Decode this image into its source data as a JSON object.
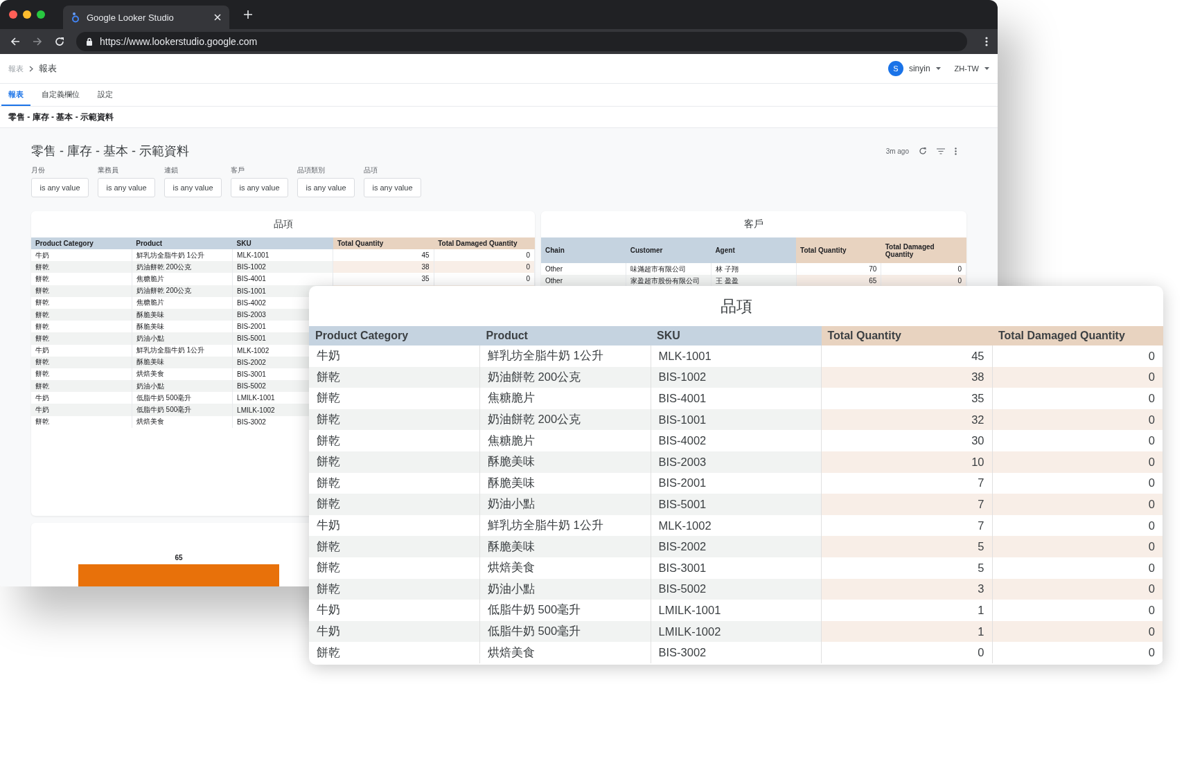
{
  "browser": {
    "tab_title": "Google Looker Studio",
    "url": "https://www.lookerstudio.google.com"
  },
  "header": {
    "breadcrumb_root": "報表",
    "breadcrumb_current": "報表",
    "user_initial": "S",
    "user_name": "sinyin",
    "language": "ZH-TW"
  },
  "tabs": [
    {
      "label": "報表",
      "selected": true
    },
    {
      "label": "自定義欄位",
      "selected": false
    },
    {
      "label": "設定",
      "selected": false
    }
  ],
  "report_name": "零售 - 庫存 - 基本 - 示範資料",
  "report": {
    "title": "零售 - 庫存 - 基本 - 示範資料",
    "updated": "3m ago",
    "filters": [
      {
        "label": "月份",
        "value": "is any value"
      },
      {
        "label": "業務員",
        "value": "is any value"
      },
      {
        "label": "連鎖",
        "value": "is any value"
      },
      {
        "label": "客戶",
        "value": "is any value"
      },
      {
        "label": "品項類別",
        "value": "is any value"
      },
      {
        "label": "品項",
        "value": "is any value"
      }
    ]
  },
  "product_table": {
    "title": "品項",
    "columns": [
      {
        "label": "Product Category",
        "kind": "dimension"
      },
      {
        "label": "Product",
        "kind": "dimension"
      },
      {
        "label": "SKU",
        "kind": "dimension"
      },
      {
        "label": "Total Quantity",
        "kind": "metric"
      },
      {
        "label": "Total Damaged Quantity",
        "kind": "metric"
      }
    ],
    "rows": [
      [
        "牛奶",
        "鮮乳坊全脂牛奶 1公升",
        "MLK-1001",
        "45",
        "0"
      ],
      [
        "餅乾",
        "奶油餅乾 200公克",
        "BIS-1002",
        "38",
        "0"
      ],
      [
        "餅乾",
        "焦糖脆片",
        "BIS-4001",
        "35",
        "0"
      ],
      [
        "餅乾",
        "奶油餅乾 200公克",
        "BIS-1001"
      ],
      [
        "餅乾",
        "焦糖脆片",
        "BIS-4002"
      ],
      [
        "餅乾",
        "酥脆美味",
        "BIS-2003"
      ],
      [
        "餅乾",
        "酥脆美味",
        "BIS-2001"
      ],
      [
        "餅乾",
        "奶油小點",
        "BIS-5001"
      ],
      [
        "牛奶",
        "鮮乳坊全脂牛奶 1公升",
        "MLK-1002"
      ],
      [
        "餅乾",
        "酥脆美味",
        "BIS-2002"
      ],
      [
        "餅乾",
        "烘焙美食",
        "BIS-3001"
      ],
      [
        "餅乾",
        "奶油小點",
        "BIS-5002"
      ],
      [
        "牛奶",
        "低脂牛奶 500毫升",
        "LMILK-1001"
      ],
      [
        "牛奶",
        "低脂牛奶 500毫升",
        "LMILK-1002"
      ],
      [
        "餅乾",
        "烘焙美食",
        "BIS-3002"
      ]
    ]
  },
  "customer_table": {
    "title": "客戶",
    "columns": [
      {
        "label": "Chain",
        "kind": "dimension"
      },
      {
        "label": "Customer",
        "kind": "dimension"
      },
      {
        "label": "Agent",
        "kind": "dimension"
      },
      {
        "label": "Total Quantity",
        "kind": "metric"
      },
      {
        "label": "Total Damaged Quantity",
        "kind": "metric"
      }
    ],
    "rows": [
      [
        "Other",
        "味滿超市有限公司",
        "林 子翔",
        "70",
        "0"
      ],
      [
        "Other",
        "家盈超市股份有限公司",
        "王 盈盈",
        "65",
        "0"
      ]
    ]
  },
  "bar_chart": {
    "data_label": "65"
  },
  "zoomed_table": {
    "title": "品項",
    "columns": [
      {
        "label": "Product Category",
        "kind": "dimension"
      },
      {
        "label": "Product",
        "kind": "dimension"
      },
      {
        "label": "SKU",
        "kind": "dimension"
      },
      {
        "label": "Total Quantity",
        "kind": "metric"
      },
      {
        "label": "Total Damaged Quantity",
        "kind": "metric"
      }
    ],
    "rows": [
      [
        "牛奶",
        "鮮乳坊全脂牛奶 1公升",
        "MLK-1001",
        "45",
        "0"
      ],
      [
        "餅乾",
        "奶油餅乾 200公克",
        "BIS-1002",
        "38",
        "0"
      ],
      [
        "餅乾",
        "焦糖脆片",
        "BIS-4001",
        "35",
        "0"
      ],
      [
        "餅乾",
        "奶油餅乾 200公克",
        "BIS-1001",
        "32",
        "0"
      ],
      [
        "餅乾",
        "焦糖脆片",
        "BIS-4002",
        "30",
        "0"
      ],
      [
        "餅乾",
        "酥脆美味",
        "BIS-2003",
        "10",
        "0"
      ],
      [
        "餅乾",
        "酥脆美味",
        "BIS-2001",
        "7",
        "0"
      ],
      [
        "餅乾",
        "奶油小點",
        "BIS-5001",
        "7",
        "0"
      ],
      [
        "牛奶",
        "鮮乳坊全脂牛奶 1公升",
        "MLK-1002",
        "7",
        "0"
      ],
      [
        "餅乾",
        "酥脆美味",
        "BIS-2002",
        "5",
        "0"
      ],
      [
        "餅乾",
        "烘焙美食",
        "BIS-3001",
        "5",
        "0"
      ],
      [
        "餅乾",
        "奶油小點",
        "BIS-5002",
        "3",
        "0"
      ],
      [
        "牛奶",
        "低脂牛奶 500毫升",
        "LMILK-1001",
        "1",
        "0"
      ],
      [
        "牛奶",
        "低脂牛奶 500毫升",
        "LMILK-1002",
        "1",
        "0"
      ],
      [
        "餅乾",
        "烘焙美食",
        "BIS-3002",
        "0",
        "0"
      ]
    ]
  }
}
